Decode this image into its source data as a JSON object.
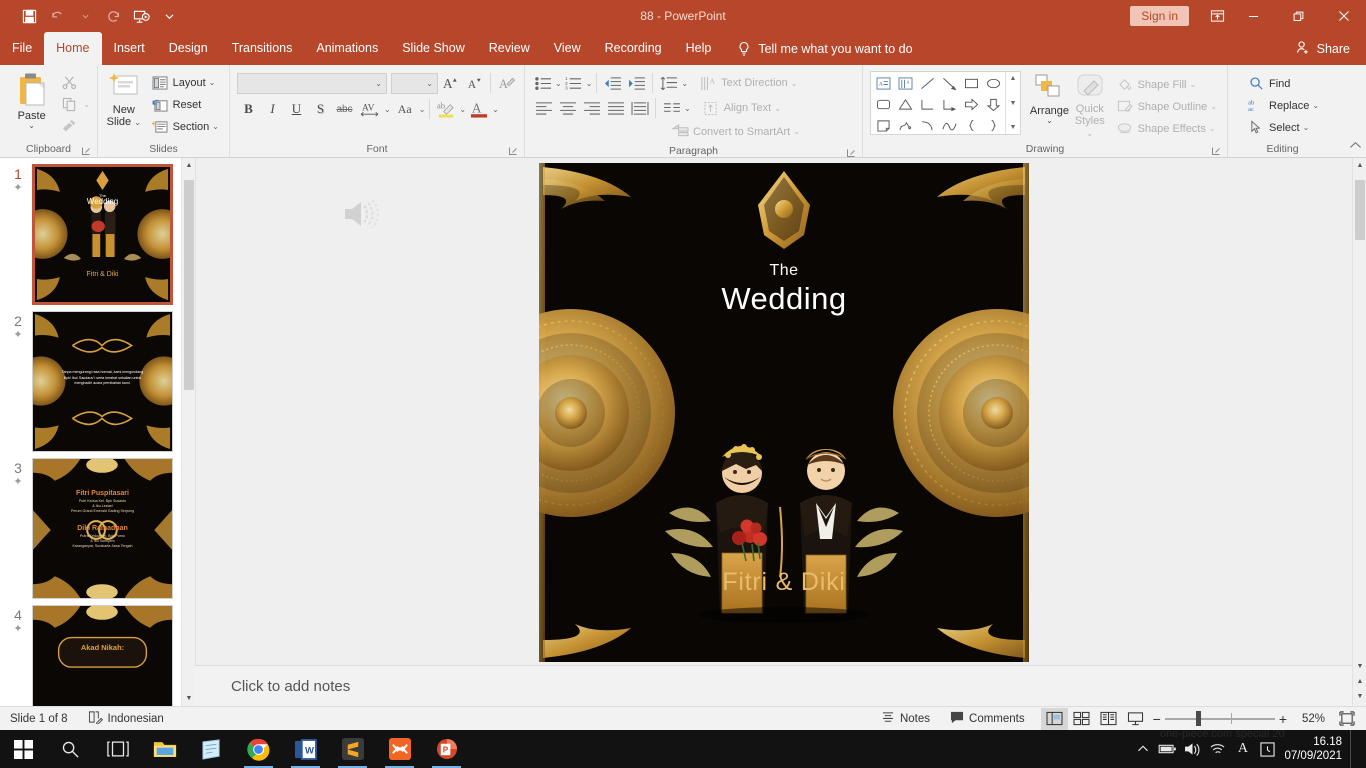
{
  "window": {
    "title": "88  -  PowerPoint",
    "sign_in": "Sign in",
    "share": "Share",
    "minimize_label": "Minimize",
    "restore_label": "Restore Down",
    "close_label": "Close",
    "ribbon_display_label": "Ribbon Display Options",
    "accent_color": "#b7472a"
  },
  "quick_access": {
    "save": "Save",
    "undo": "Undo",
    "redo": "Repeat",
    "start_from_beginning": "Start From Beginning",
    "customize": "Customize Quick Access Toolbar"
  },
  "tabs": [
    {
      "label": "File",
      "active": false
    },
    {
      "label": "Home",
      "active": true
    },
    {
      "label": "Insert",
      "active": false
    },
    {
      "label": "Design",
      "active": false
    },
    {
      "label": "Transitions",
      "active": false
    },
    {
      "label": "Animations",
      "active": false
    },
    {
      "label": "Slide Show",
      "active": false
    },
    {
      "label": "Review",
      "active": false
    },
    {
      "label": "View",
      "active": false
    },
    {
      "label": "Recording",
      "active": false
    },
    {
      "label": "Help",
      "active": false
    }
  ],
  "tell_me": {
    "text": "Tell me what you want to do"
  },
  "ribbon": {
    "clipboard": {
      "label": "Clipboard",
      "paste": "Paste",
      "cut": "Cut",
      "copy": "Copy",
      "format_painter": "Format Painter"
    },
    "slides": {
      "label": "Slides",
      "new_slide": "New\nSlide",
      "new_slide_line1": "New",
      "new_slide_line2": "Slide",
      "layout": "Layout",
      "reset": "Reset",
      "section": "Section"
    },
    "font": {
      "label": "Font",
      "font_name_value": "",
      "font_size_value": "",
      "increase_font": "A",
      "decrease_font": "A",
      "clear_formatting": "Clear All Formatting",
      "bold": "B",
      "italic": "I",
      "underline": "U",
      "shadow": "S",
      "strikethrough": "abc",
      "character_spacing": "AV",
      "change_case": "Aa",
      "text_highlight": "ab",
      "font_color": "A"
    },
    "paragraph": {
      "label": "Paragraph",
      "text_direction": "Text Direction",
      "align_text": "Align Text",
      "convert_to_smartart": "Convert to SmartArt"
    },
    "drawing": {
      "label": "Drawing",
      "arrange": "Arrange",
      "quick_styles_line1": "Quick",
      "quick_styles_line2": "Styles",
      "shape_fill": "Shape Fill",
      "shape_outline": "Shape Outline",
      "shape_effects": "Shape Effects"
    },
    "editing": {
      "label": "Editing",
      "find": "Find",
      "replace": "Replace",
      "select": "Select"
    }
  },
  "thumbnails": [
    {
      "number": "1",
      "selected": true,
      "starred": true
    },
    {
      "number": "2",
      "selected": false,
      "starred": true
    },
    {
      "number": "3",
      "selected": false,
      "starred": true
    },
    {
      "number": "4",
      "selected": false,
      "starred": true
    }
  ],
  "slide_thumb_text": {
    "s1_the": "The",
    "s1_wedding": "Wedding",
    "s1_names": "Fitri & Diki",
    "s2_body": "Tanpa mengurangi rasa hormat, kami mengundang Bpk/ Ibu/ Saudara/ i serta kerabat sekalian untuk menghadiri acara pernikahan kami.",
    "s3_bride": "Fitri Puspitasari",
    "s3_bride_sub1": "Putri Kedua Kel. Bpk Susanto",
    "s3_bride_sub2": "& Ibu Lestari",
    "s3_bride_sub3": "Perum Grand Emerald Gading Serpong",
    "s3_groom": "Diki Ramadhan",
    "s3_groom_sub1": "Putra Kedua Kel. Bpk Purno",
    "s3_groom_sub2": "& Ibu Sumiyem",
    "s3_groom_sub3": "Karanganyar, Surakarta Jawa Tengah",
    "s4_title": "Akad Nikah:"
  },
  "slide": {
    "the": "The",
    "wedding": "Wedding",
    "names": "Fitri & Diki",
    "audio_icon_label": "Audio",
    "gold": "#d9a441",
    "gold_light": "#f0cf8a",
    "background": "#0a0604"
  },
  "notes": {
    "placeholder": "Click to add notes"
  },
  "status": {
    "slide_counter": "Slide 1 of 8",
    "language": "Indonesian",
    "notes": "Notes",
    "comments": "Comments",
    "accessibility_label": "Accessibility Checker",
    "normal_view": "Normal",
    "slide_sorter": "Slide Sorter",
    "reading_view": "Reading View",
    "slide_show": "Slide Show",
    "zoom_out": "−",
    "zoom_in": "+",
    "zoom_level": "52%",
    "fit_slide": "Fit slide to current window"
  },
  "taskbar": {
    "apps": [
      {
        "name": "start-button",
        "label": "Start",
        "open": false
      },
      {
        "name": "search-button",
        "label": "Search",
        "open": false
      },
      {
        "name": "task-view",
        "label": "Task View",
        "open": false
      },
      {
        "name": "file-explorer",
        "label": "File Explorer",
        "open": false
      },
      {
        "name": "notes-app",
        "label": "Sticky Notes",
        "open": false
      },
      {
        "name": "chrome",
        "label": "Google Chrome",
        "open": true
      },
      {
        "name": "word",
        "label": "Word",
        "open": true
      },
      {
        "name": "sublime-text",
        "label": "Sublime Text",
        "open": true
      },
      {
        "name": "xampp",
        "label": "XAMPP",
        "open": true
      },
      {
        "name": "powerpoint",
        "label": "PowerPoint",
        "open": true
      }
    ],
    "tray": {
      "show_hidden": "Show hidden icons",
      "battery": "Battery",
      "volume": "Speakers",
      "network": "Network",
      "language": "A",
      "action_center": "Notifications"
    },
    "clock": {
      "time": "16.18",
      "date": "07/09/2021"
    },
    "wallpaper_text": "one-piece.com special 20"
  }
}
